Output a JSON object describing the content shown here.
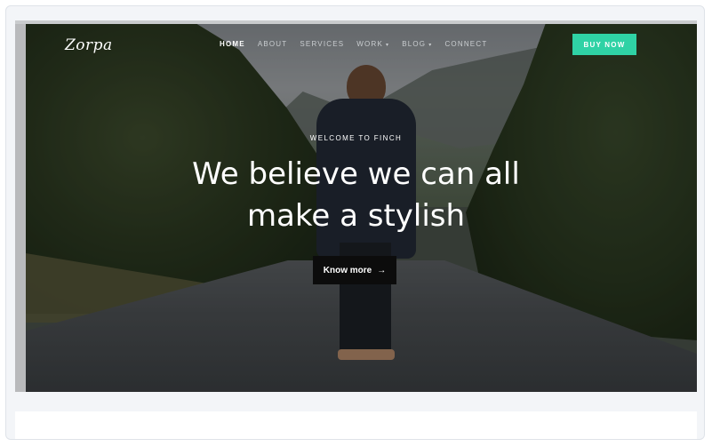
{
  "brand": {
    "logo": "Zorpa"
  },
  "nav": {
    "items": [
      {
        "label": "HOME",
        "active": true,
        "dropdown": false
      },
      {
        "label": "ABOUT",
        "active": false,
        "dropdown": false
      },
      {
        "label": "SERVICES",
        "active": false,
        "dropdown": false
      },
      {
        "label": "WORK",
        "active": false,
        "dropdown": true
      },
      {
        "label": "BLOG",
        "active": false,
        "dropdown": true
      },
      {
        "label": "CONNECT",
        "active": false,
        "dropdown": false
      }
    ],
    "buy_label": "BUY NOW"
  },
  "hero": {
    "eyebrow": "WELCOME TO FINCH",
    "headline_line1": "We believe we can all",
    "headline_line2": "make a stylish",
    "cta_label": "Know more",
    "cta_icon": "arrow-right-icon"
  },
  "colors": {
    "accent": "#2fd2a5",
    "cta_bg": "#0c0c0c"
  }
}
